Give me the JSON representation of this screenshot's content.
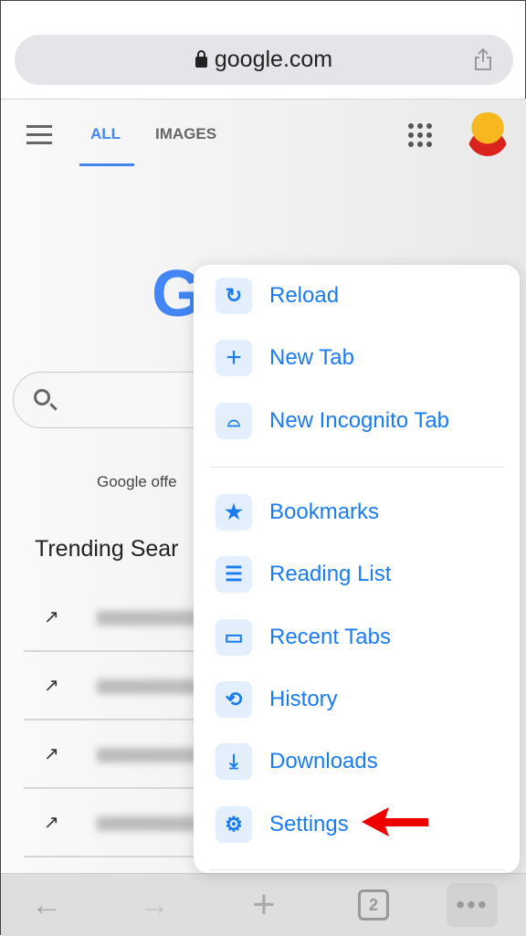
{
  "browser": {
    "url": "google.com",
    "icons": {
      "lock": "lock-icon",
      "share": "share-icon"
    }
  },
  "google": {
    "tabs": [
      {
        "label": "ALL",
        "active": true
      },
      {
        "label": "IMAGES",
        "active": false
      }
    ],
    "logo_partial": "G",
    "offer_text": "Google offe",
    "trending_title": "Trending Sear",
    "trending_rows": 4,
    "accent": "#4285f4"
  },
  "menu": {
    "accent": "#1a7cf0",
    "items": [
      {
        "label": "Reload",
        "icon": "reload-icon"
      },
      {
        "label": "New Tab",
        "icon": "plus-icon"
      },
      {
        "label": "New Incognito Tab",
        "icon": "incognito-icon"
      },
      {
        "label": "Bookmarks",
        "icon": "star-icon"
      },
      {
        "label": "Reading List",
        "icon": "list-icon"
      },
      {
        "label": "Recent Tabs",
        "icon": "devices-icon"
      },
      {
        "label": "History",
        "icon": "history-icon"
      },
      {
        "label": "Downloads",
        "icon": "download-icon"
      },
      {
        "label": "Settings",
        "icon": "gear-icon"
      }
    ]
  },
  "toolbar": {
    "tab_count": "2"
  },
  "annotation": {
    "arrow_color": "#ee0000"
  }
}
